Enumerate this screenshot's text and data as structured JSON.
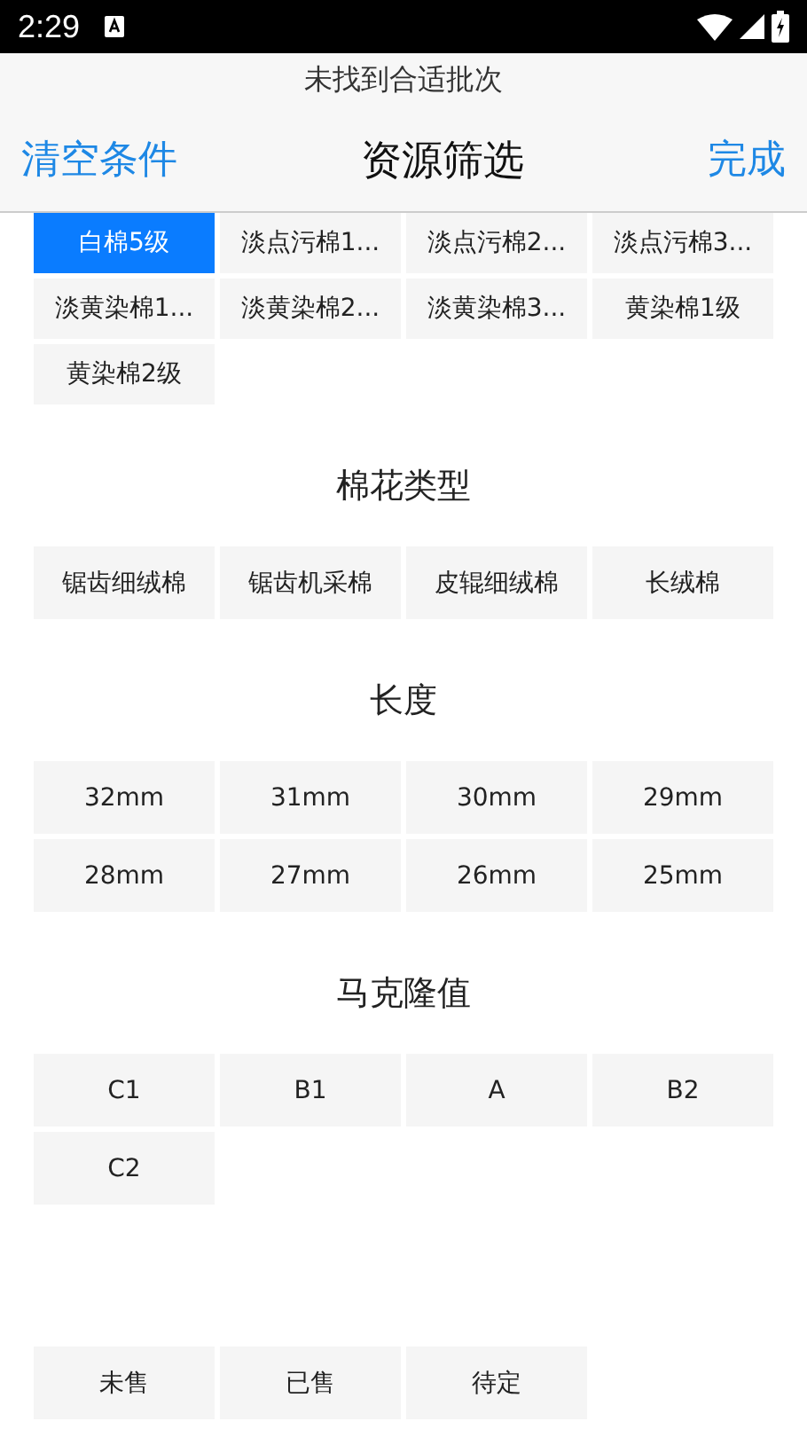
{
  "status_bar": {
    "time": "2:29"
  },
  "header": {
    "notice": "未找到合适批次",
    "left_action": "清空条件",
    "title": "资源筛选",
    "right_action": "完成"
  },
  "sections": [
    {
      "options": [
        {
          "label": "白棉5级",
          "selected": true
        },
        {
          "label": "淡点污棉1...",
          "selected": false
        },
        {
          "label": "淡点污棉2...",
          "selected": false
        },
        {
          "label": "淡点污棉3...",
          "selected": false
        },
        {
          "label": "淡黄染棉1...",
          "selected": false
        },
        {
          "label": "淡黄染棉2...",
          "selected": false
        },
        {
          "label": "淡黄染棉3...",
          "selected": false
        },
        {
          "label": "黄染棉1级",
          "selected": false
        },
        {
          "label": "黄染棉2级",
          "selected": false
        }
      ]
    },
    {
      "title": "棉花类型",
      "options": [
        {
          "label": "锯齿细绒棉",
          "selected": false
        },
        {
          "label": "锯齿机采棉",
          "selected": false
        },
        {
          "label": "皮辊细绒棉",
          "selected": false
        },
        {
          "label": "长绒棉",
          "selected": false
        }
      ]
    },
    {
      "title": "长度",
      "options": [
        {
          "label": "32mm",
          "selected": false
        },
        {
          "label": "31mm",
          "selected": false
        },
        {
          "label": "30mm",
          "selected": false
        },
        {
          "label": "29mm",
          "selected": false
        },
        {
          "label": "28mm",
          "selected": false
        },
        {
          "label": "27mm",
          "selected": false
        },
        {
          "label": "26mm",
          "selected": false
        },
        {
          "label": "25mm",
          "selected": false
        }
      ]
    },
    {
      "title": "马克隆值",
      "options": [
        {
          "label": "C1",
          "selected": false
        },
        {
          "label": "B1",
          "selected": false
        },
        {
          "label": "A",
          "selected": false
        },
        {
          "label": "B2",
          "selected": false
        },
        {
          "label": "C2",
          "selected": false
        }
      ]
    },
    {
      "options": [
        {
          "label": "未售",
          "selected": false
        },
        {
          "label": "已售",
          "selected": false
        },
        {
          "label": "待定",
          "selected": false
        }
      ]
    }
  ]
}
